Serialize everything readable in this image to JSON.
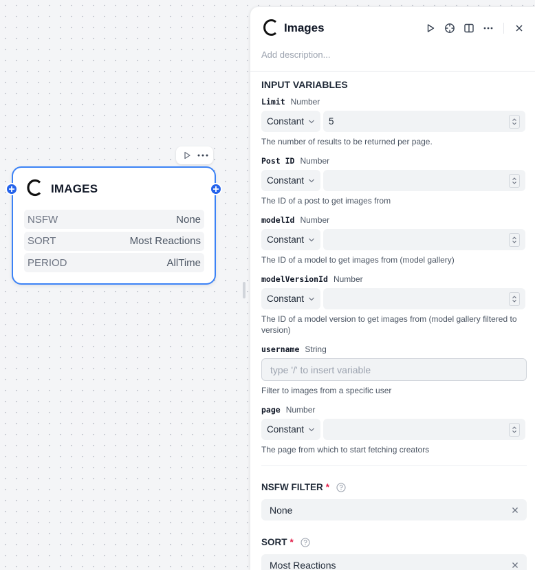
{
  "node": {
    "title": "IMAGES",
    "rows": [
      {
        "key": "NSFW",
        "value": "None"
      },
      {
        "key": "SORT",
        "value": "Most Reactions"
      },
      {
        "key": "PERIOD",
        "value": "AllTime"
      }
    ],
    "toolbar": {
      "run_icon": "play-icon",
      "more_icon": "more-horizontal-icon"
    }
  },
  "panel": {
    "title": "Images",
    "description_placeholder": "Add description...",
    "actions": [
      "play-icon",
      "crosshair-icon",
      "split-view-icon",
      "more-horizontal-icon",
      "close-icon"
    ],
    "input_variables_title": "INPUT VARIABLES",
    "variables": [
      {
        "name": "Limit",
        "type": "Number",
        "mode": "Constant",
        "value": "5",
        "hint": "The number of results to be returned per page."
      },
      {
        "name": "Post ID",
        "type": "Number",
        "mode": "Constant",
        "value": "",
        "hint": "The ID of a post to get images from"
      },
      {
        "name": "modelId",
        "type": "Number",
        "mode": "Constant",
        "value": "",
        "hint": "The ID of a model to get images from (model gallery)"
      },
      {
        "name": "modelVersionId",
        "type": "Number",
        "mode": "Constant",
        "value": "",
        "hint": "The ID of a model version to get images from (model gallery filtered to version)"
      }
    ],
    "username": {
      "name": "username",
      "type": "String",
      "placeholder": "type '/' to insert variable",
      "hint": "Filter to images from a specific user"
    },
    "page": {
      "name": "page",
      "type": "Number",
      "mode": "Constant",
      "value": "",
      "hint": "The page from which to start fetching creators"
    },
    "nsfw_filter": {
      "label": "NSFW FILTER",
      "required": "*",
      "value": "None"
    },
    "sort": {
      "label": "SORT",
      "required": "*",
      "value": "Most Reactions"
    }
  },
  "colors": {
    "accent": "#3b82f6",
    "handle": "#2563eb",
    "required": "#e11d48"
  }
}
